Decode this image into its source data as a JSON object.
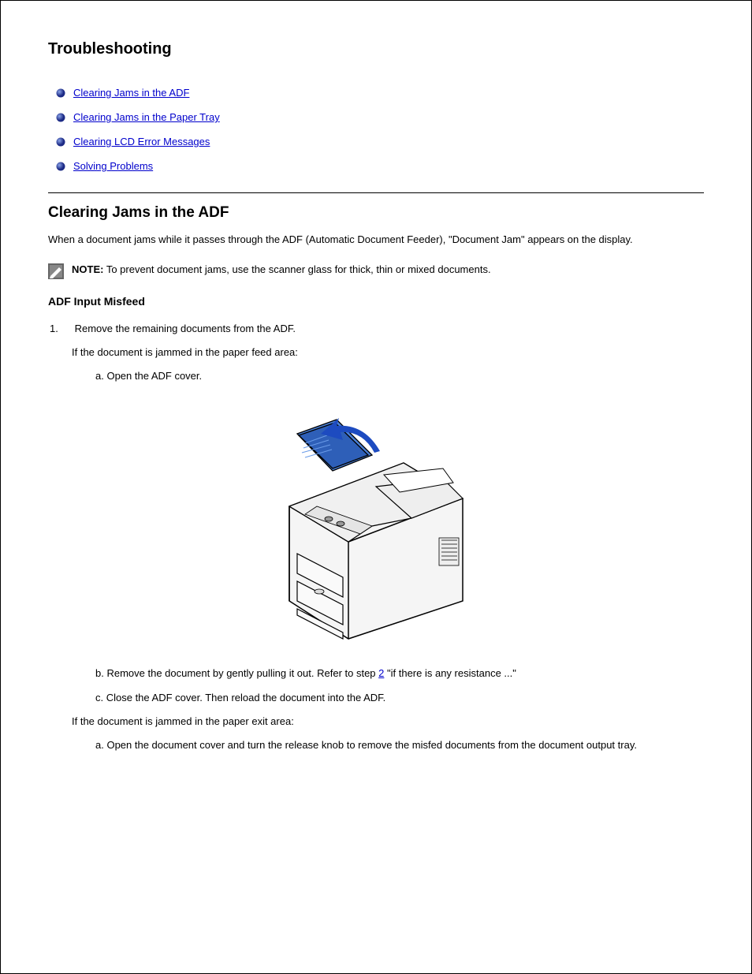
{
  "title": "Troubleshooting",
  "links": [
    "Clearing Jams in the ADF",
    "Clearing Jams in the Paper Tray",
    "Clearing LCD Error Messages",
    "Solving Problems"
  ],
  "section": {
    "heading": "Clearing Jams in the ADF",
    "intro": "When a document jams while it passes through the ADF (Automatic Document Feeder), \"Document Jam\" appears on the display.",
    "note_label": "NOTE:",
    "note_text": " To prevent document jams, use the scanner glass for thick, thin or mixed documents.",
    "subheading": "ADF Input Misfeed",
    "step1_num": "1.",
    "step1_text": " Remove the remaining documents from the ADF.",
    "step1_cont": "If the document is jammed in the paper feed area:",
    "step1_a": "a. Open the ADF cover.",
    "step1_b_pre": "b. Remove the document by gently pulling it out. Refer to step ",
    "step1_b_link": "2",
    "step1_b_post": " \"if there is any resistance ...\"",
    "step1_c": "c. Close the ADF cover. Then reload the document into the ADF.",
    "step_if": "If the document is jammed in the paper exit area:",
    "step_if_a": "a. Open the document cover and turn the release knob to remove the misfed documents from the document output tray."
  }
}
